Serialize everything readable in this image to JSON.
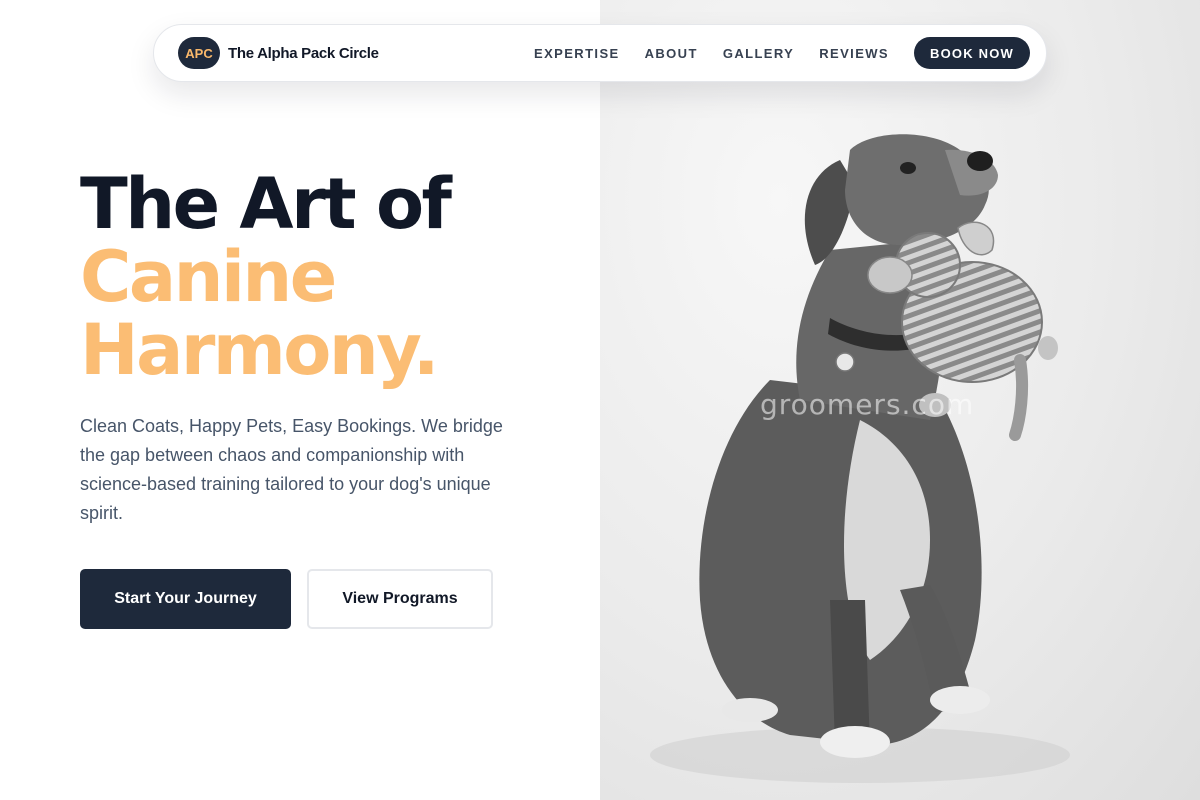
{
  "nav": {
    "logo_text": "APC",
    "brand_name": "The Alpha Pack Circle",
    "links": [
      "EXPERTISE",
      "ABOUT",
      "GALLERY",
      "REVIEWS"
    ],
    "cta": "BOOK NOW"
  },
  "hero": {
    "headline_line1": "The Art of",
    "headline_line2": "Canine",
    "headline_line3": "Harmony.",
    "subtext": "Clean Coats, Happy Pets, Easy Bookings. We bridge the gap between chaos and companionship with science-based training tailored to your dog's unique spirit.",
    "primary_button": "Start Your Journey",
    "secondary_button": "View Programs",
    "photo_watermark": "groomers.com"
  },
  "colors": {
    "navy": "#1e293b",
    "accent": "#fbbd74",
    "text_muted": "#475569"
  }
}
